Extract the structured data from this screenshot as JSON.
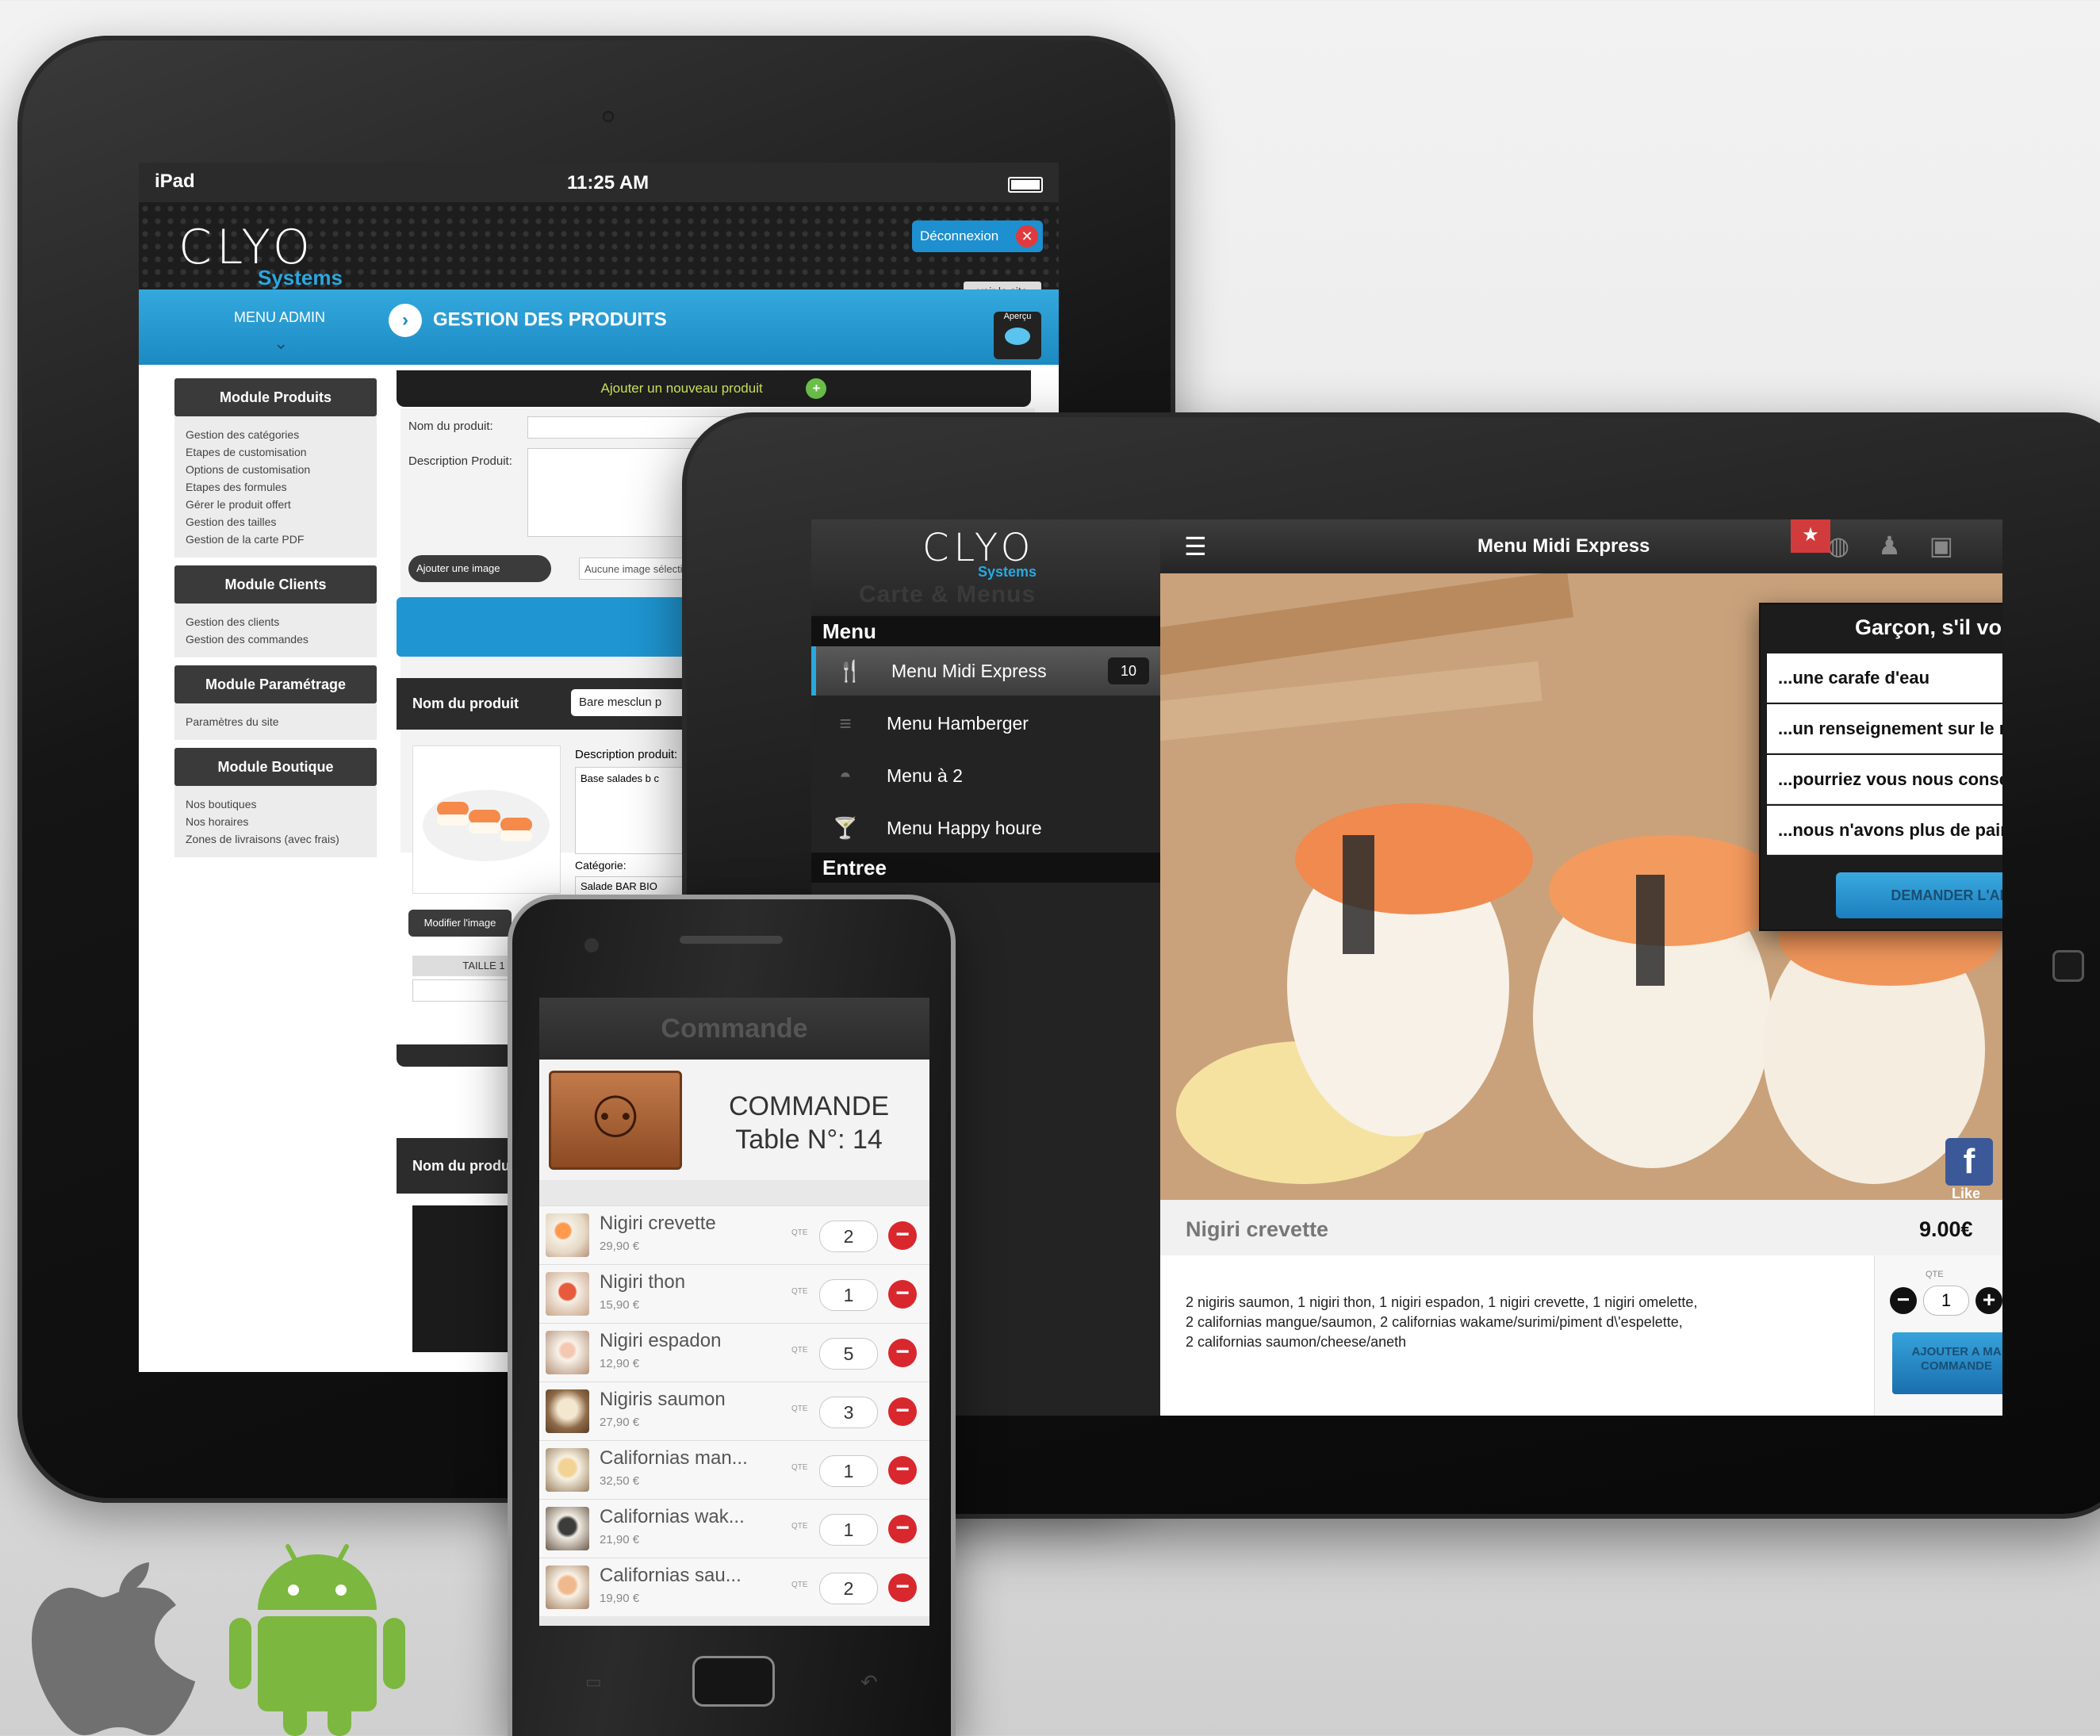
{
  "colors": {
    "accent": "#29a8e0",
    "danger": "#d9272e",
    "dark": "#1d1d1d"
  },
  "admin_ipad": {
    "status": {
      "carrier": "iPad",
      "time": "11:25 AM"
    },
    "logo": {
      "brand": "CLYO",
      "sub": "Systems"
    },
    "logout_label": "Déconnexion",
    "view_site_label": "voir le site",
    "menu_admin_label": "MENU ADMIN",
    "page_title": "GESTION DES PRODUITS",
    "preview_label": "Aperçu",
    "add_product_label": "Ajouter un nouveau produit",
    "modules": [
      {
        "title": "Module Produits",
        "items": [
          "Gestion des catégories",
          "Etapes de customisation",
          "Options de customisation",
          "Etapes des formules",
          "Gérer le produit offert",
          "Gestion des tailles",
          "Gestion de la carte PDF"
        ]
      },
      {
        "title": "Module Clients",
        "items": [
          "Gestion des clients",
          "Gestion des commandes"
        ]
      },
      {
        "title": "Module Paramétrage",
        "items": [
          "Paramètres du site"
        ]
      },
      {
        "title": "Module Boutique",
        "items": [
          "Nos boutiques",
          "Nos horaires",
          "Zones de livraisons (avec frais)"
        ]
      }
    ],
    "form": {
      "product_name_label": "Nom du produit:",
      "product_desc_label": "Description Produit:",
      "add_image_label": "Ajouter une image",
      "no_image_label": "Aucune image sélectionnée"
    },
    "card": {
      "name_label": "Nom du produit",
      "name_value": "Bare mesclun p",
      "desc_label": "Description produit:",
      "desc_value": "Base salades b c",
      "category_label": "Catégorie:",
      "category_value": "Salade BAR BIO",
      "modify_image_label": "Modifier l'image",
      "table_label": "TAILLE 1"
    },
    "card2_name_label": "Nom du produ"
  },
  "client_ipad": {
    "logo": {
      "brand": "CLYO",
      "sub": "Systems"
    },
    "carte_label": "Carte & Menus",
    "sections": [
      {
        "title": "Menu",
        "items": [
          {
            "icon": "cutlery-icon",
            "label": "Menu Midi Express",
            "badge": "10"
          },
          {
            "icon": "burger-icon",
            "label": "Menu Hamberger"
          },
          {
            "icon": "cloche-icon",
            "label": "Menu à 2"
          },
          {
            "icon": "cocktail-icon",
            "label": "Menu Happy houre"
          }
        ]
      },
      {
        "title": "Entree"
      }
    ],
    "topbar_title": "Menu Midi Express",
    "waiter_popup": {
      "title": "Garçon, s'il vous plait...",
      "options": [
        "...une carafe d'eau",
        "...un renseignement sur le menu du jour.",
        "...pourriez vous nous conseillez ?",
        "...nous n'avons plus de pain à table."
      ],
      "bill_button": "DEMANDER L'ADDITION"
    },
    "like_label": "Like",
    "product": {
      "name": "Nigiri crevette",
      "price": "9.00€",
      "description_lines": [
        "2 nigiris saumon, 1 nigiri thon, 1 nigiri espadon, 1 nigiri crevette, 1 nigiri omelette,",
        "2 californias mangue/saumon, 2 californias wakame/surimi/piment d\\'espelette,",
        "2 californias saumon/cheese/aneth"
      ],
      "qte_label": "QTE",
      "quantity": "1",
      "add_button": "AJOUTER A MA COMMANDE"
    }
  },
  "phone": {
    "header": "Commande",
    "order_title": "COMMANDE",
    "table_label": "Table N°: 14",
    "qte_label": "QTE",
    "items": [
      {
        "name": "Nigiri crevette",
        "price": "29,90 €",
        "qty": "2"
      },
      {
        "name": "Nigiri thon",
        "price": "15,90 €",
        "qty": "1"
      },
      {
        "name": "Nigiri espadon",
        "price": "12,90 €",
        "qty": "5"
      },
      {
        "name": "Nigiris saumon",
        "price": "27,90 €",
        "qty": "3"
      },
      {
        "name": "Californias man...",
        "price": "32,50 €",
        "qty": "1"
      },
      {
        "name": "Californias wak...",
        "price": "21,90 €",
        "qty": "1"
      },
      {
        "name": "Californias sau...",
        "price": "19,90 €",
        "qty": "2"
      }
    ]
  },
  "platform_icons": [
    "apple-icon",
    "android-icon"
  ]
}
